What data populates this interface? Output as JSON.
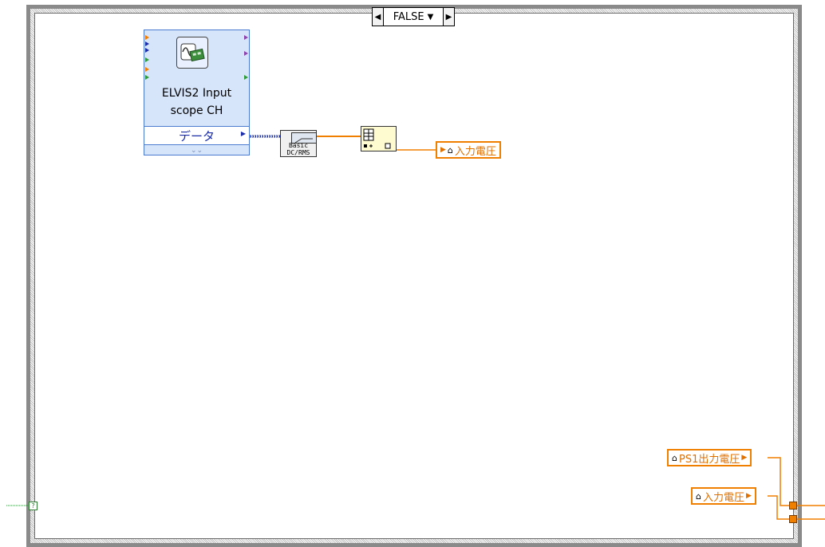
{
  "case_structure": {
    "selector_value": "FALSE",
    "selector_left_arrow": "◀",
    "selector_right_arrow": "▶",
    "selector_dropdown": "▼"
  },
  "express_vi": {
    "title": "ELVIS2 Input\nscope CH",
    "output_label": "データ",
    "expand_glyph": "⌄⌄",
    "icon": "oscilloscope-icon"
  },
  "dc_rms_vi": {
    "label": "Basic\nDC/RMS",
    "icon": "meter-icon"
  },
  "array_node": {
    "icon": "build-array-icon"
  },
  "local_variables": {
    "input_voltage_top": "入力電圧",
    "ps1_output_voltage": "PS1出力電圧",
    "input_voltage_bottom": "入力電圧"
  },
  "boolean_tunnel": {
    "glyph": "?"
  },
  "colors": {
    "waveform_wire": "#1a2ca8",
    "numeric_wire": "#f07f00",
    "boolean_wire": "#2e9a3a",
    "express_vi_bg": "#d7e5fb"
  }
}
